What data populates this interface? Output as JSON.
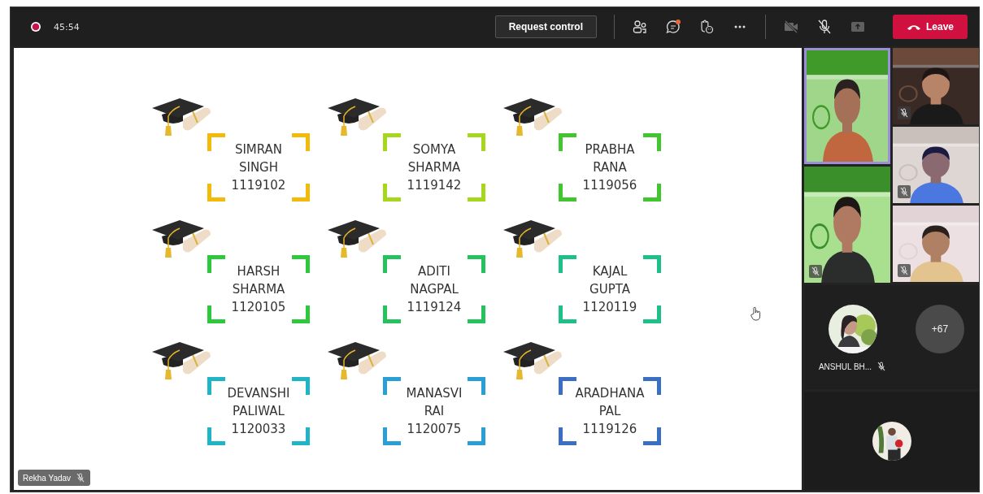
{
  "meeting": {
    "recording": true,
    "elapsed": "45:54"
  },
  "toolbar": {
    "request_control": "Request control",
    "chat_unread": true,
    "camera_on": false,
    "camera_disabled": true,
    "mic_on": false,
    "share_disabled": true,
    "leave": "Leave"
  },
  "slide": {
    "students": [
      {
        "first": "SIMRAN",
        "last": "SINGH",
        "roll": "1119102",
        "color": "#f2bb0a"
      },
      {
        "first": "SOMYA",
        "last": "SHARMA",
        "roll": "1119142",
        "color": "#a6d71c"
      },
      {
        "first": "PRABHA",
        "last": "RANA",
        "roll": "1119056",
        "color": "#42c630"
      },
      {
        "first": "HARSH",
        "last": "SHARMA",
        "roll": "1120105",
        "color": "#2ec83c"
      },
      {
        "first": "ADITI",
        "last": "NAGPAL",
        "roll": "1119124",
        "color": "#26c25e"
      },
      {
        "first": "KAJAL",
        "last": "GUPTA",
        "roll": "1120119",
        "color": "#1fbf8a"
      },
      {
        "first": "DEVANSHI",
        "last": "PALIWAL",
        "roll": "1120033",
        "color": "#1fb5c6"
      },
      {
        "first": "MANASVI",
        "last": "RAI",
        "roll": "1120075",
        "color": "#2a9fd6"
      },
      {
        "first": "ARADHANA",
        "last": "PAL",
        "roll": "1119126",
        "color": "#3a6fc4"
      }
    ]
  },
  "presenter": {
    "name": "Rekha Yadav",
    "muted": true
  },
  "video_tiles": [
    {
      "active_speaker": true,
      "muted": false
    },
    {
      "active_speaker": false,
      "muted": true
    },
    {
      "active_speaker": false,
      "muted": true
    },
    {
      "active_speaker": false,
      "muted": true
    },
    {
      "active_speaker": false,
      "muted": true
    }
  ],
  "participants": [
    {
      "name": "ANSHUL BH...",
      "muted": true
    }
  ],
  "overflow": "+67"
}
